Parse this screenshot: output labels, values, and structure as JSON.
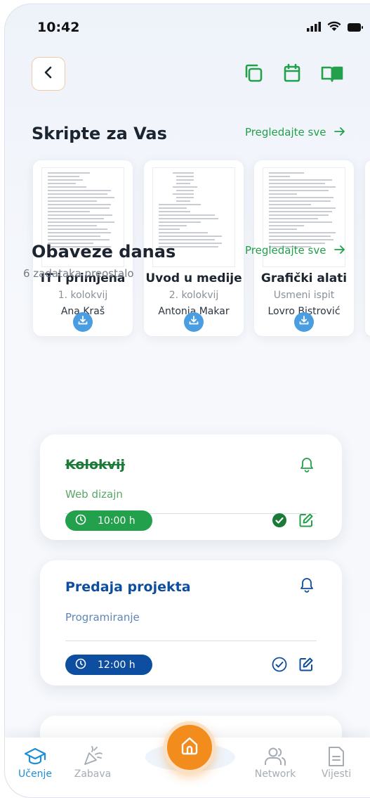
{
  "status": {
    "time": "10:42"
  },
  "colors": {
    "accent_green": "#22a04b",
    "accent_blue": "#0d4ea0",
    "orange": "#f28c1d",
    "active_nav": "#1d8fd8"
  },
  "scripts_section": {
    "title": "Skripte za Vas",
    "see_all": "Pregledajte sve",
    "items": [
      {
        "title": "IT i primjena",
        "exam": "1. kolokvij",
        "author": "Ana Kraš"
      },
      {
        "title": "Uvod u medije",
        "exam": "2. kolokvij",
        "author": "Antonia Makar"
      },
      {
        "title": "Grafički alati",
        "exam": "Usmeni ispit",
        "author": "Lovro Bistrović"
      }
    ]
  },
  "tasks_section": {
    "title": "Obaveze danas",
    "see_all": "Pregledajte sve",
    "remaining": "6 zadataka preostalo",
    "items": [
      {
        "title": "Kolokvij",
        "subject": "Web dizajn",
        "time": "10:00 h",
        "completed": true
      },
      {
        "title": "Predaja projekta",
        "subject": "Programiranje",
        "time": "12:00 h",
        "completed": false
      }
    ]
  },
  "nav": {
    "items": [
      {
        "label": "Učenje",
        "icon": "graduation-cap-icon",
        "active": true
      },
      {
        "label": "Zabava",
        "icon": "party-popper-icon",
        "active": false
      },
      {
        "label": "",
        "icon": "home-icon",
        "active": false
      },
      {
        "label": "Network",
        "icon": "users-icon",
        "active": false
      },
      {
        "label": "Vijesti",
        "icon": "news-icon",
        "active": false
      }
    ]
  }
}
